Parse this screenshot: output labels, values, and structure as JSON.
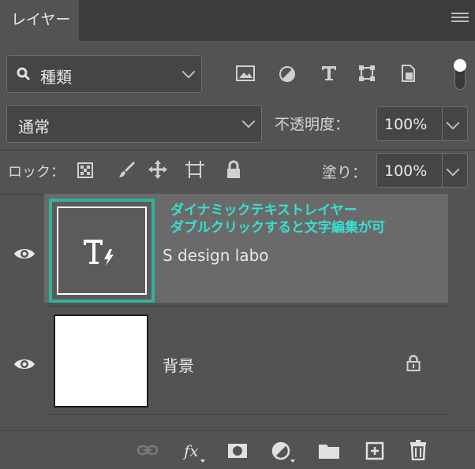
{
  "panel": {
    "tab_label": "レイヤー"
  },
  "filter": {
    "kind_label": "種類"
  },
  "blend": {
    "mode": "通常",
    "opacity_label": "不透明度：",
    "opacity_value": "100%"
  },
  "lock": {
    "label": "ロック：",
    "fill_label": "塗り：",
    "fill_value": "100%"
  },
  "annotation": {
    "line1": "ダイナミックテキストレイヤー",
    "line2": "ダブルクリックすると文字編集が可"
  },
  "layers": [
    {
      "name": "S design labo"
    },
    {
      "name": "背景"
    }
  ]
}
